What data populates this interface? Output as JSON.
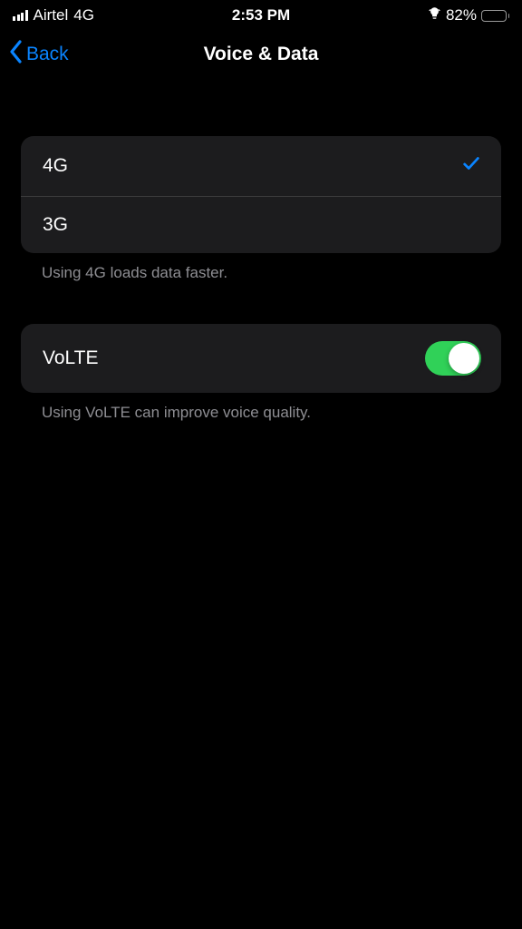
{
  "statusBar": {
    "carrier": "Airtel",
    "network": "4G",
    "time": "2:53 PM",
    "batteryPct": "82%"
  },
  "nav": {
    "backLabel": "Back",
    "title": "Voice & Data"
  },
  "networkOptions": {
    "items": [
      {
        "label": "4G",
        "selected": true
      },
      {
        "label": "3G",
        "selected": false
      }
    ],
    "footer": "Using 4G loads data faster."
  },
  "volte": {
    "label": "VoLTE",
    "enabled": true,
    "footer": "Using VoLTE can improve voice quality."
  }
}
